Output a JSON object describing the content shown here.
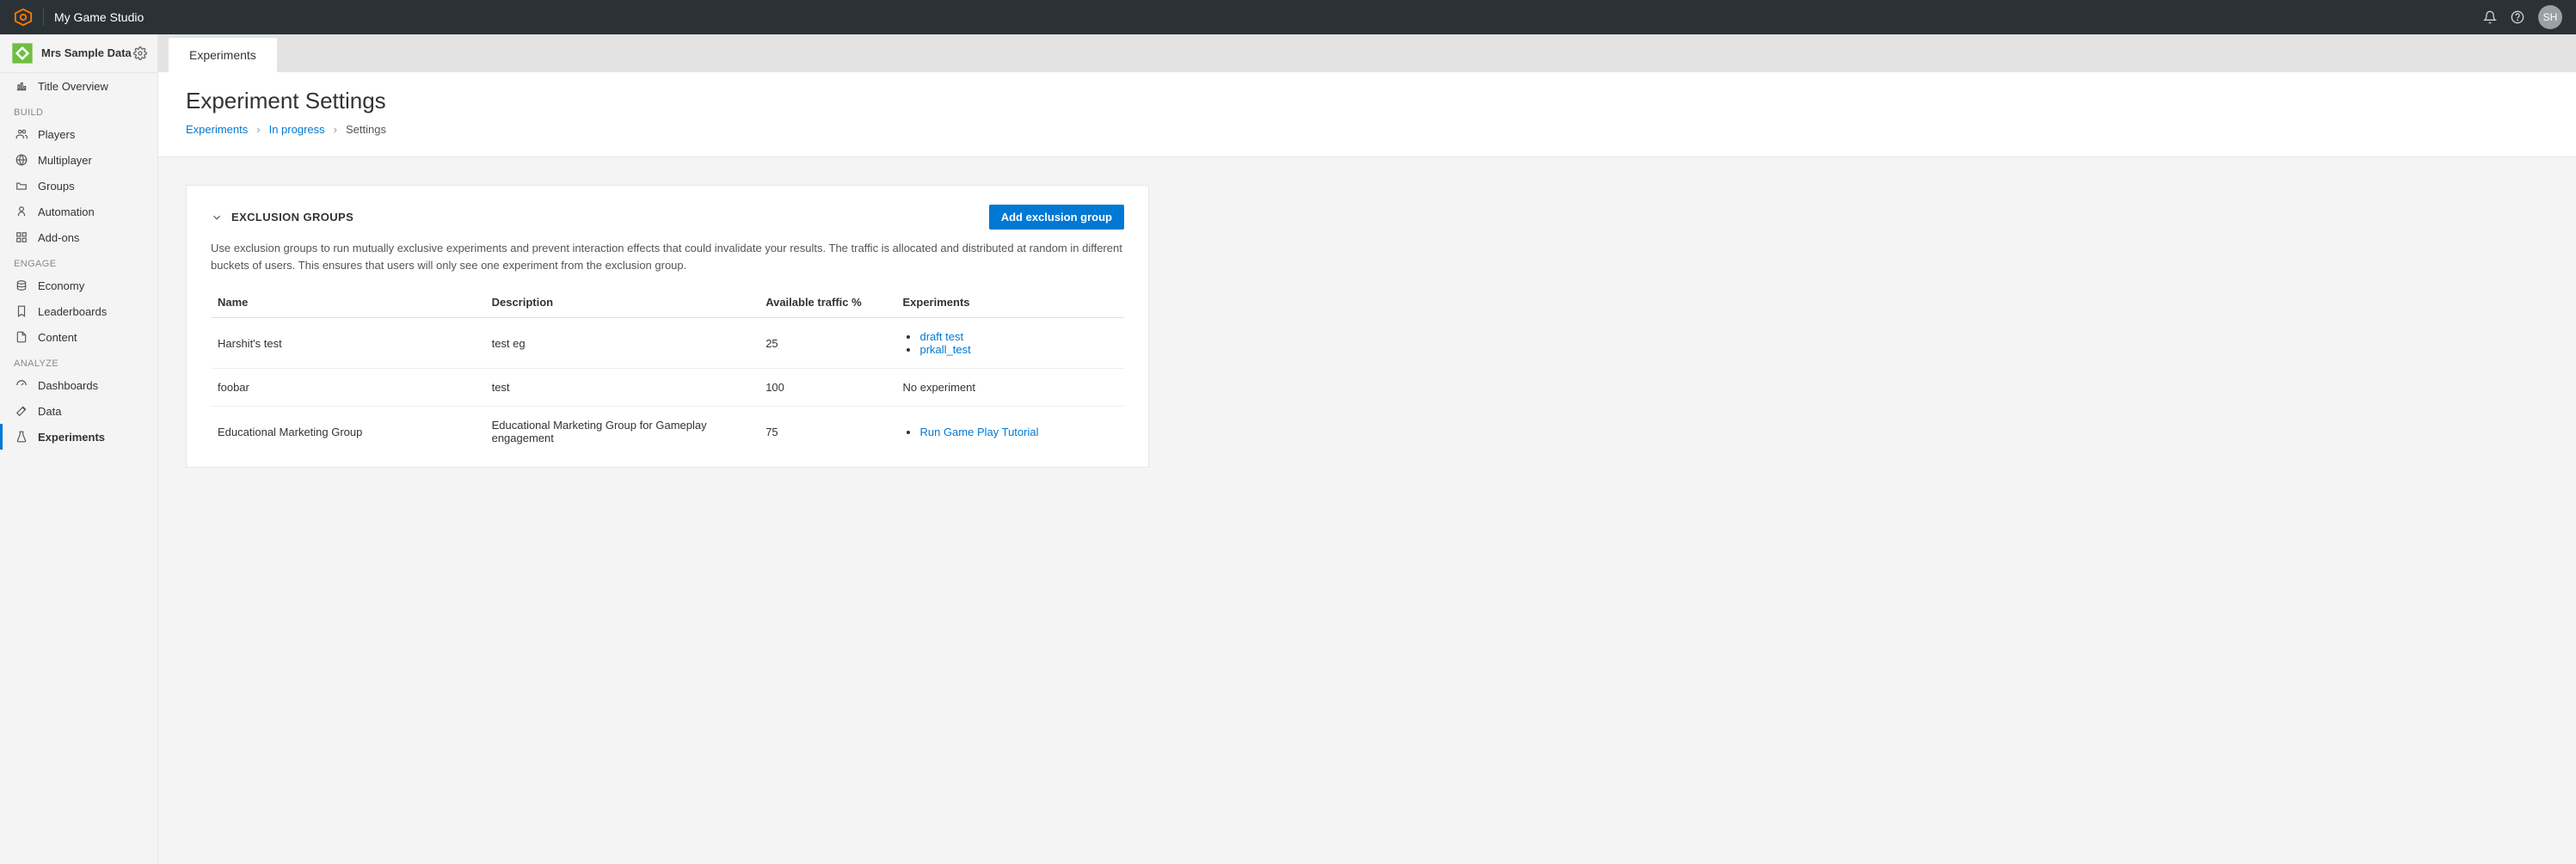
{
  "header": {
    "studio_name": "My Game Studio",
    "avatar_initials": "SH"
  },
  "sidebar": {
    "title_name": "Mrs Sample Data",
    "overview_label": "Title Overview",
    "sections": {
      "build": {
        "label": "BUILD",
        "items": [
          "Players",
          "Multiplayer",
          "Groups",
          "Automation",
          "Add-ons"
        ]
      },
      "engage": {
        "label": "ENGAGE",
        "items": [
          "Economy",
          "Leaderboards",
          "Content"
        ]
      },
      "analyze": {
        "label": "ANALYZE",
        "items": [
          "Dashboards",
          "Data",
          "Experiments"
        ]
      }
    }
  },
  "main": {
    "tab_label": "Experiments",
    "page_title": "Experiment Settings",
    "breadcrumb": {
      "root": "Experiments",
      "mid": "In progress",
      "current": "Settings"
    },
    "card": {
      "title": "EXCLUSION GROUPS",
      "add_button": "Add exclusion group",
      "description": "Use exclusion groups to run mutually exclusive experiments and prevent interaction effects that could invalidate your results. The traffic is allocated and distributed at random in different buckets of users. This ensures that users will only see one experiment from the exclusion group.",
      "columns": {
        "name": "Name",
        "description": "Description",
        "traffic": "Available traffic %",
        "experiments": "Experiments"
      },
      "rows": [
        {
          "name": "Harshit's test",
          "description": "test eg",
          "traffic": "25",
          "experiments": [
            "draft test",
            "prkall_test"
          ],
          "no_experiment": ""
        },
        {
          "name": "foobar",
          "description": "test",
          "traffic": "100",
          "experiments": [],
          "no_experiment": "No experiment"
        },
        {
          "name": "Educational Marketing Group",
          "description": "Educational Marketing Group for Gameplay engagement",
          "traffic": "75",
          "experiments": [
            "Run Game Play Tutorial"
          ],
          "no_experiment": ""
        }
      ]
    }
  }
}
